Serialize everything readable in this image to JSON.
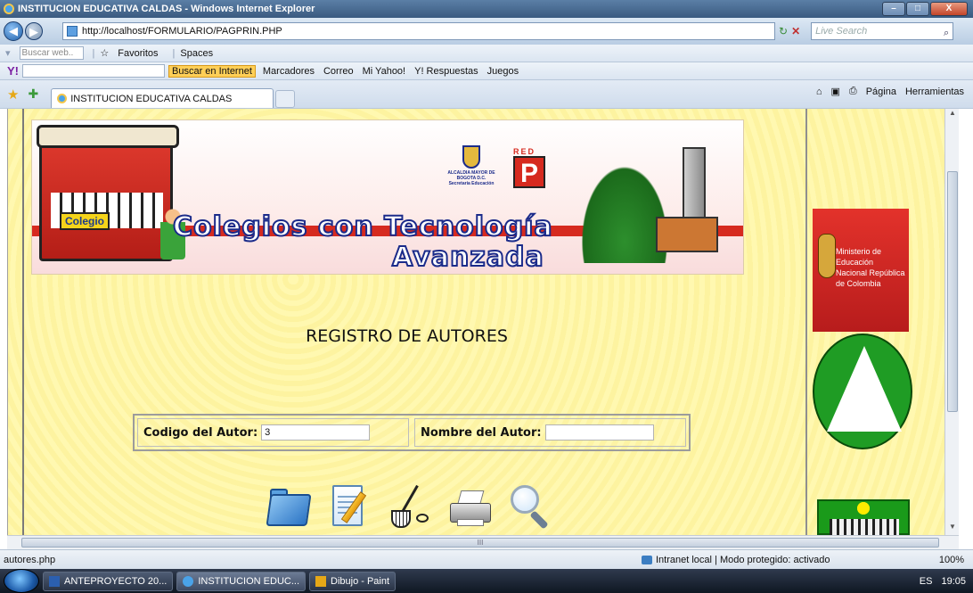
{
  "window": {
    "title": "INSTITUCION EDUCATIVA CALDAS - Windows Internet Explorer",
    "min": "–",
    "max": "□",
    "close": "X"
  },
  "address": {
    "url": "http://localhost/FORMULARIO/PAGPRIN.PHP",
    "refresh": "↻",
    "stop": "✕",
    "search_placeholder": "Live Search",
    "search_icon": "⌕"
  },
  "toolbar1": {
    "search_placeholder": "Buscar web..",
    "favoritos": "Favoritos",
    "spaces": "Spaces"
  },
  "toolbar2": {
    "yahoo": "Y!",
    "buscar": "Buscar en Internet",
    "marcadores": "Marcadores",
    "correo": "Correo",
    "miyahoo": "Mi Yahoo!",
    "respuestas": "Y! Respuestas",
    "juegos": "Juegos"
  },
  "tabs": {
    "active_tab": "INSTITUCION EDUCATIVA CALDAS",
    "pagina": "Página",
    "herramientas": "Herramientas"
  },
  "banner": {
    "school_sign": "Colegio",
    "title_line1": "Colegios con Tecnología",
    "title_line2": "Avanzada",
    "alcaldia": "ALCALDIA MAYOR DE BOGOTA D.C.",
    "alcaldia_sub": "Secretaría Educación",
    "red": "RED",
    "red_letter": "P"
  },
  "page": {
    "heading": "REGISTRO DE AUTORES",
    "codigo_label": "Codigo del Autor:",
    "codigo_value": "3",
    "nombre_label": "Nombre del Autor:",
    "nombre_value": ""
  },
  "logos": {
    "ministerio": "Ministerio de Educación Nacional República de Colombia"
  },
  "hscroll_grip": "III",
  "status": {
    "left": "autores.php",
    "zone": "Intranet local | Modo protegido: activado",
    "zoom": "100%"
  },
  "taskbar": {
    "items": [
      "ANTEPROYECTO 20...",
      "INSTITUCION EDUC...",
      "Dibujo - Paint"
    ],
    "lang": "ES",
    "clock": "19:05"
  },
  "colors": {
    "accent": "#1b2b8a",
    "banner_red": "#d62a1f",
    "page_bg": "#fdf3a0"
  }
}
